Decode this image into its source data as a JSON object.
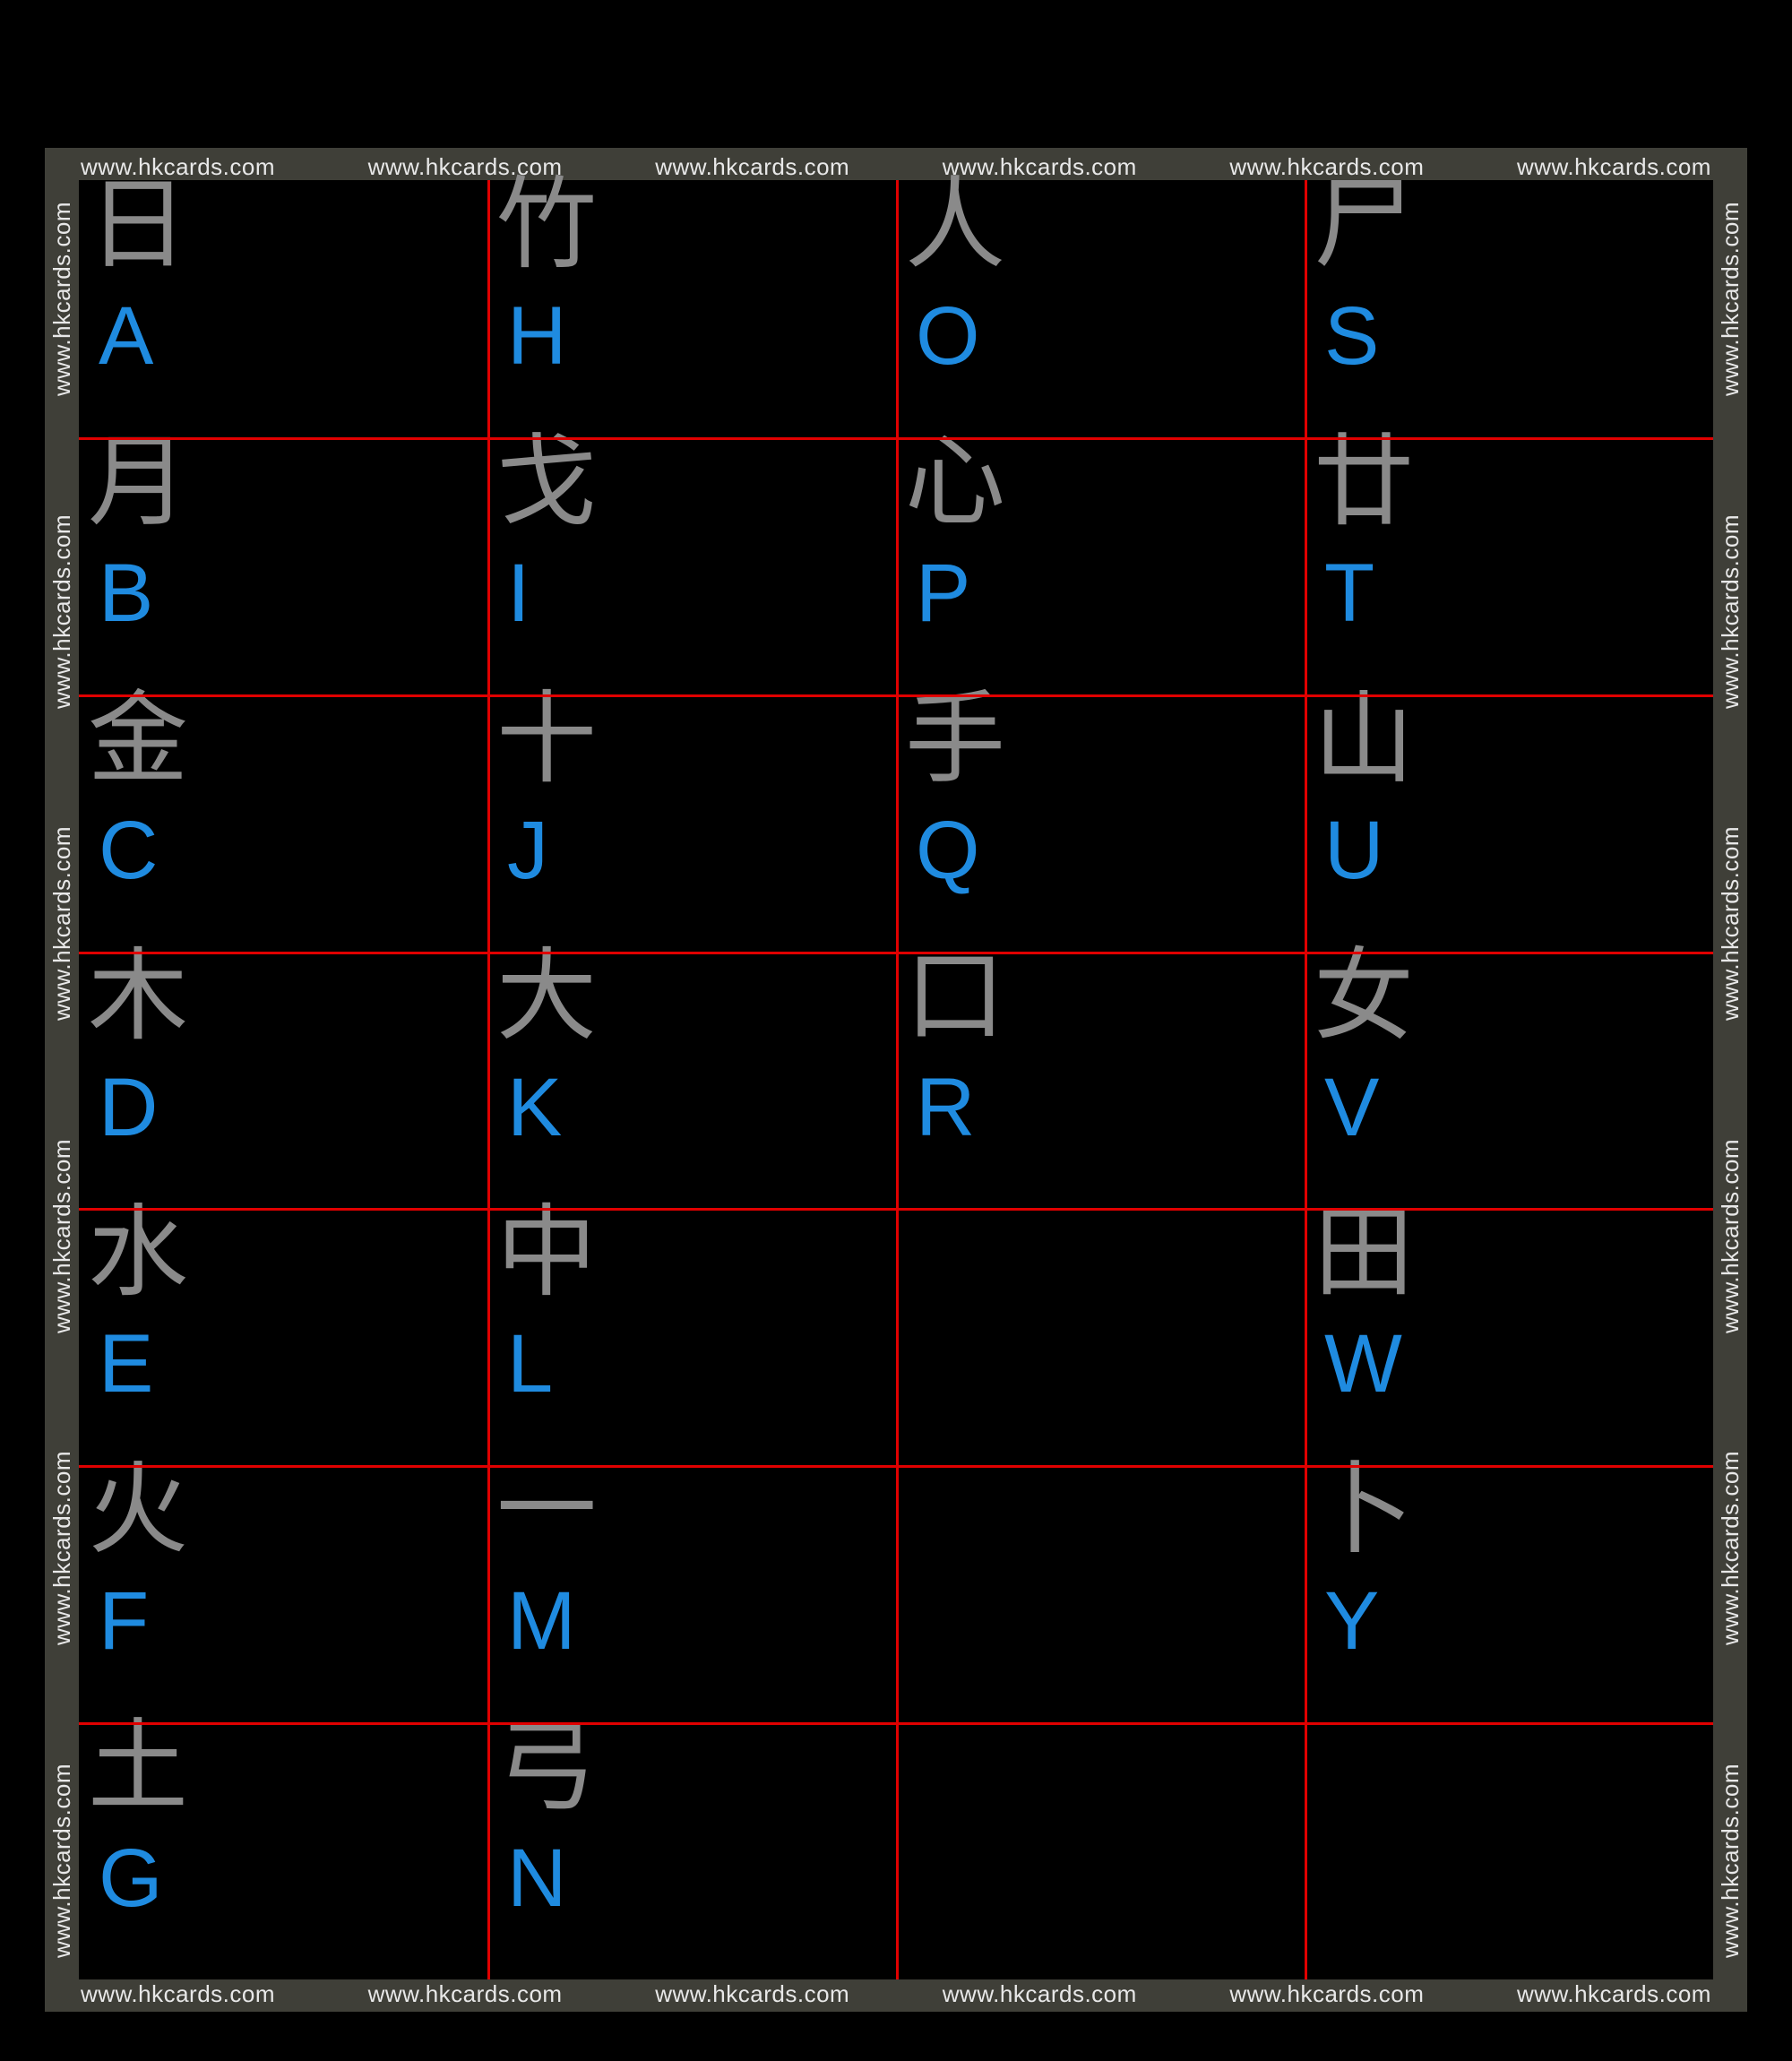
{
  "watermark": "www.hkcards.com",
  "colors": {
    "background": "#000000",
    "frame": "#3f3f38",
    "gridline": "#e00000",
    "radical": "#8a8a8a",
    "letter": "#1f8be0",
    "watermark_text": "#e8e8e8"
  },
  "grid": {
    "rows": 7,
    "cols": 4
  },
  "cells": [
    {
      "row": 0,
      "col": 0,
      "radical": "日",
      "letter": "A"
    },
    {
      "row": 0,
      "col": 1,
      "radical": "竹",
      "letter": "H"
    },
    {
      "row": 0,
      "col": 2,
      "radical": "人",
      "letter": "O"
    },
    {
      "row": 0,
      "col": 3,
      "radical": "尸",
      "letter": "S"
    },
    {
      "row": 1,
      "col": 0,
      "radical": "月",
      "letter": "B"
    },
    {
      "row": 1,
      "col": 1,
      "radical": "戈",
      "letter": "I"
    },
    {
      "row": 1,
      "col": 2,
      "radical": "心",
      "letter": "P"
    },
    {
      "row": 1,
      "col": 3,
      "radical": "廿",
      "letter": "T"
    },
    {
      "row": 2,
      "col": 0,
      "radical": "金",
      "letter": "C"
    },
    {
      "row": 2,
      "col": 1,
      "radical": "十",
      "letter": "J"
    },
    {
      "row": 2,
      "col": 2,
      "radical": "手",
      "letter": "Q"
    },
    {
      "row": 2,
      "col": 3,
      "radical": "山",
      "letter": "U"
    },
    {
      "row": 3,
      "col": 0,
      "radical": "木",
      "letter": "D"
    },
    {
      "row": 3,
      "col": 1,
      "radical": "大",
      "letter": "K"
    },
    {
      "row": 3,
      "col": 2,
      "radical": "口",
      "letter": "R"
    },
    {
      "row": 3,
      "col": 3,
      "radical": "女",
      "letter": "V"
    },
    {
      "row": 4,
      "col": 0,
      "radical": "水",
      "letter": "E"
    },
    {
      "row": 4,
      "col": 1,
      "radical": "中",
      "letter": "L"
    },
    {
      "row": 4,
      "col": 2,
      "radical": "",
      "letter": ""
    },
    {
      "row": 4,
      "col": 3,
      "radical": "田",
      "letter": "W"
    },
    {
      "row": 5,
      "col": 0,
      "radical": "火",
      "letter": "F"
    },
    {
      "row": 5,
      "col": 1,
      "radical": "一",
      "letter": "M"
    },
    {
      "row": 5,
      "col": 2,
      "radical": "",
      "letter": ""
    },
    {
      "row": 5,
      "col": 3,
      "radical": "卜",
      "letter": "Y"
    },
    {
      "row": 6,
      "col": 0,
      "radical": "土",
      "letter": "G"
    },
    {
      "row": 6,
      "col": 1,
      "radical": "弓",
      "letter": "N"
    },
    {
      "row": 6,
      "col": 2,
      "radical": "",
      "letter": ""
    },
    {
      "row": 6,
      "col": 3,
      "radical": "",
      "letter": ""
    }
  ]
}
